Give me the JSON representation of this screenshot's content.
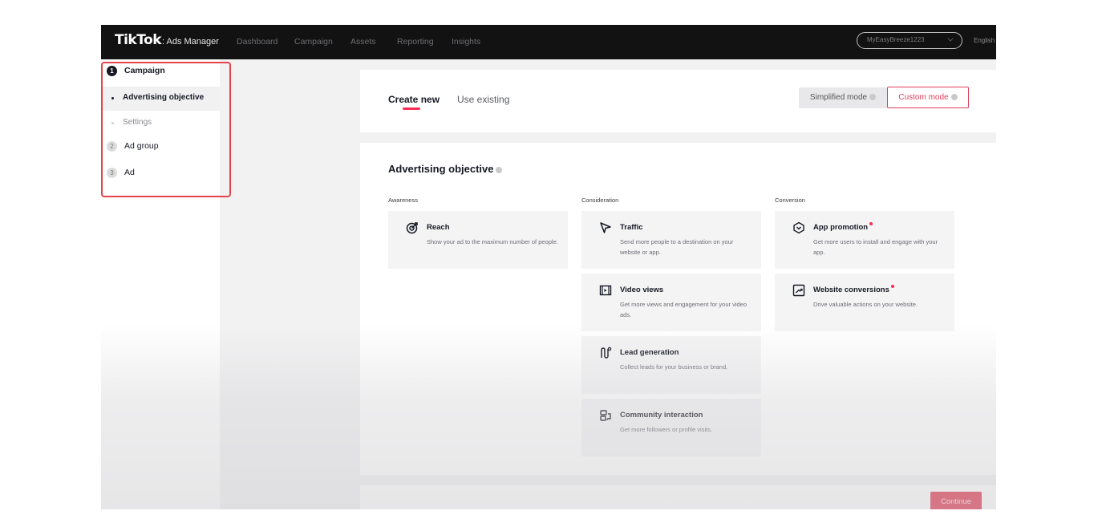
{
  "topnav": {
    "logo": "TikTok",
    "logo_sub": ": Ads Manager",
    "links": [
      "Dashboard",
      "Campaign",
      "Assets",
      "Reporting",
      "Insights"
    ],
    "account": "MyEasyBreeze1223",
    "language": "English"
  },
  "sidebar": {
    "steps": [
      {
        "num": "1",
        "label": "Campaign"
      },
      {
        "num": "2",
        "label": "Ad group"
      },
      {
        "num": "3",
        "label": "Ad"
      }
    ],
    "substeps": [
      "Advertising objective",
      "Settings"
    ]
  },
  "header": {
    "tabs": [
      "Create new",
      "Use existing"
    ],
    "simplified_mode": "Simplified mode",
    "custom_mode": "Custom mode"
  },
  "objective": {
    "title": "Advertising objective",
    "columns": [
      "Awareness",
      "Consideration",
      "Conversion"
    ],
    "awareness": [
      {
        "icon": "reach-icon",
        "title": "Reach",
        "desc": "Show your ad to the maximum number of people."
      }
    ],
    "consideration": [
      {
        "icon": "traffic-icon",
        "title": "Traffic",
        "desc": "Send more people to a destination on your website or app."
      },
      {
        "icon": "video-views-icon",
        "title": "Video views",
        "desc": "Get more views and engagement for your video ads."
      },
      {
        "icon": "lead-generation-icon",
        "title": "Lead generation",
        "desc": "Collect leads for your business or brand."
      },
      {
        "icon": "community-interaction-icon",
        "title": "Community interaction",
        "desc": "Get more followers or profile visits."
      }
    ],
    "conversion": [
      {
        "icon": "app-promotion-icon",
        "title": "App promotion",
        "desc": "Get more users to install and engage with your app."
      },
      {
        "icon": "website-conversions-icon",
        "title": "Website conversions",
        "desc": "Drive valuable actions on your website."
      }
    ]
  },
  "footer": {
    "continue": "Continue"
  },
  "colors": {
    "accent": "#fe2c55",
    "nav_bg": "#121212",
    "highlight_border": "#e5434c"
  }
}
